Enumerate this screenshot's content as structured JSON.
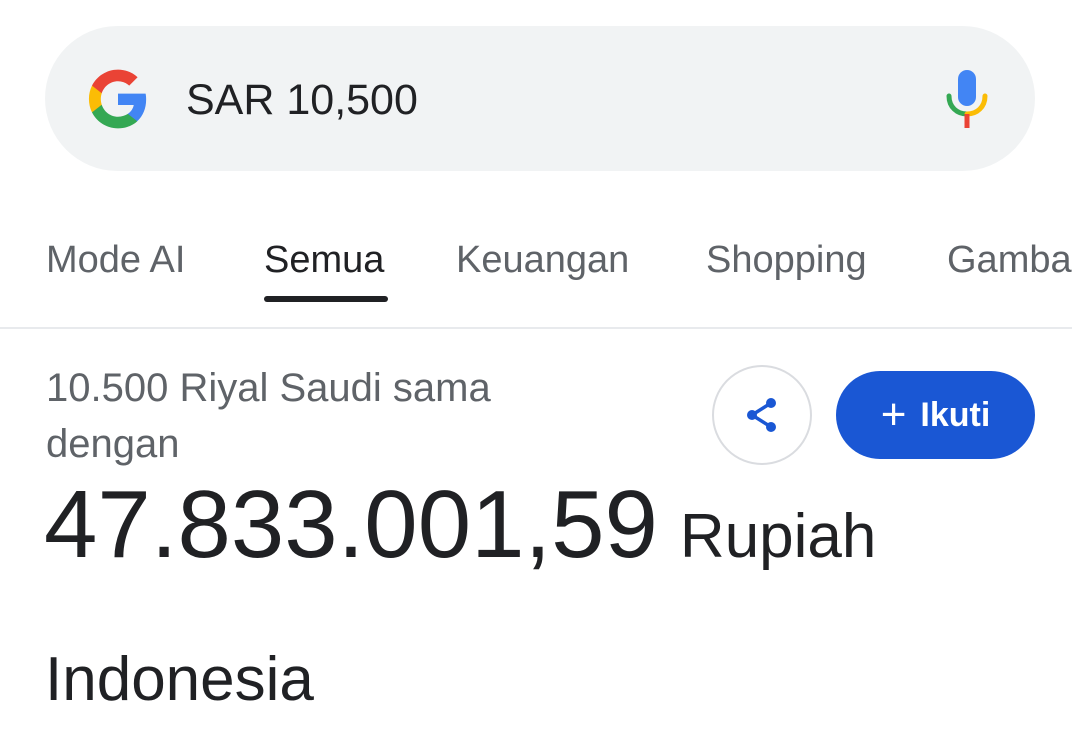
{
  "search": {
    "query": "SAR 10,500",
    "logo_icon": "google-g-logo",
    "mic_icon": "microphone-icon"
  },
  "tabs": [
    {
      "label": "Mode AI",
      "active": false
    },
    {
      "label": "Semua",
      "active": true
    },
    {
      "label": "Keuangan",
      "active": false
    },
    {
      "label": "Shopping",
      "active": false
    },
    {
      "label": "Gamba",
      "active": false
    }
  ],
  "result": {
    "label": "10.500 Riyal Saudi sama dengan",
    "amount": "47.833.001,59",
    "currency": "Rupiah",
    "country": "Indonesia"
  },
  "actions": {
    "share_icon": "share-icon",
    "follow_label": "Ikuti",
    "follow_icon": "plus-icon"
  },
  "colors": {
    "accent": "#1a57d4",
    "search_bg": "#f1f3f4",
    "text_primary": "#202124",
    "text_secondary": "#5f6368"
  }
}
